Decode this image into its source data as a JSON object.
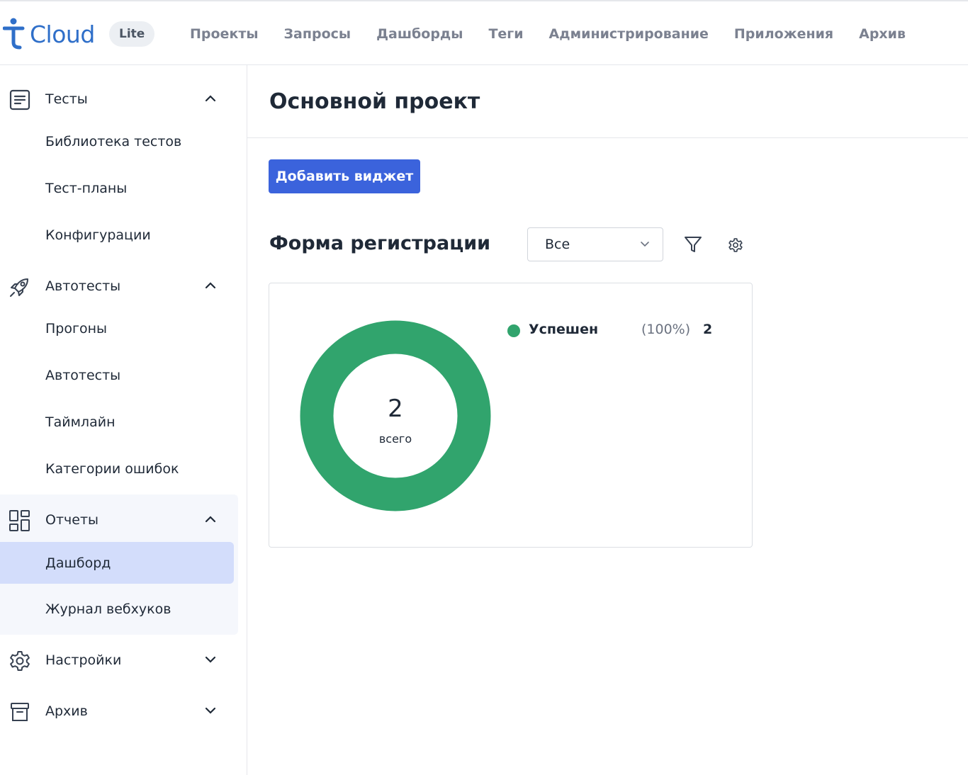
{
  "header": {
    "logo_text": "Cloud",
    "badge": "Lite",
    "nav": [
      "Проекты",
      "Запросы",
      "Дашборды",
      "Теги",
      "Администрирование",
      "Приложения",
      "Архив"
    ]
  },
  "sidebar": {
    "groups": [
      {
        "label": "Тесты",
        "icon": "document-list-icon",
        "expanded": true,
        "items": [
          "Библиотека тестов",
          "Тест-планы",
          "Конфигурации"
        ]
      },
      {
        "label": "Автотесты",
        "icon": "rocket-icon",
        "expanded": true,
        "items": [
          "Прогоны",
          "Автотесты",
          "Таймлайн",
          "Категории ошибок"
        ]
      },
      {
        "label": "Отчеты",
        "icon": "grid-icon",
        "expanded": true,
        "items": [
          "Дашборд",
          "Журнал вебхуков"
        ],
        "active_item": "Дашборд"
      },
      {
        "label": "Настройки",
        "icon": "gear-icon",
        "expanded": false,
        "items": []
      },
      {
        "label": "Архив",
        "icon": "archive-box-icon",
        "expanded": false,
        "items": []
      }
    ]
  },
  "main": {
    "title": "Основной проект",
    "add_widget_label": "Добавить виджет",
    "widget": {
      "title": "Форма регистрации",
      "filter_value": "Все",
      "total_value": "2",
      "total_label": "всего",
      "legend": [
        {
          "name": "Успешен",
          "percent": "(100%)",
          "count": "2",
          "color": "#31a46d"
        }
      ]
    }
  },
  "chart_data": {
    "type": "pie",
    "variant": "donut",
    "categories": [
      "Успешен"
    ],
    "values": [
      2
    ],
    "colors": [
      "#31a46d"
    ],
    "center_text": "2",
    "center_subtext": "всего"
  },
  "colors": {
    "accent": "#3b63dc",
    "active_item_bg": "#d3ddfb",
    "success": "#31a46d",
    "logo": "#2f6fc9"
  }
}
